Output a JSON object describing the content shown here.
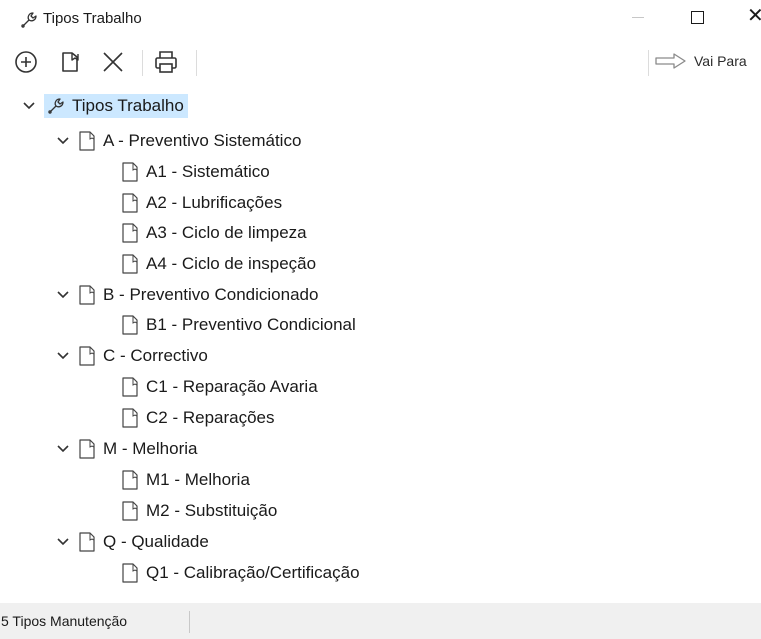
{
  "window": {
    "title": "Tipos Trabalho"
  },
  "toolbar": {
    "goto_label": "Vai Para"
  },
  "tree": {
    "root": "Tipos Trabalho",
    "groups": [
      {
        "label": "A - Preventivo Sistemático",
        "children": [
          "A1 - Sistemático",
          "A2 - Lubrificações",
          "A3 - Ciclo de limpeza",
          "A4 - Ciclo de inspeção"
        ]
      },
      {
        "label": "B - Preventivo Condicionado",
        "children": [
          "B1 - Preventivo Condicional"
        ]
      },
      {
        "label": "C - Correctivo",
        "children": [
          "C1 - Reparação Avaria",
          "C2 - Reparações"
        ]
      },
      {
        "label": "M - Melhoria",
        "children": [
          "M1 - Melhoria",
          "M2 - Substituição"
        ]
      },
      {
        "label": "Q - Qualidade",
        "children": [
          "Q1 - Calibração/Certificação"
        ]
      }
    ]
  },
  "status": {
    "text": "5 Tipos Manutenção"
  },
  "colors": {
    "selection": "#cce8ff",
    "statusbar": "#f0f0f0"
  }
}
